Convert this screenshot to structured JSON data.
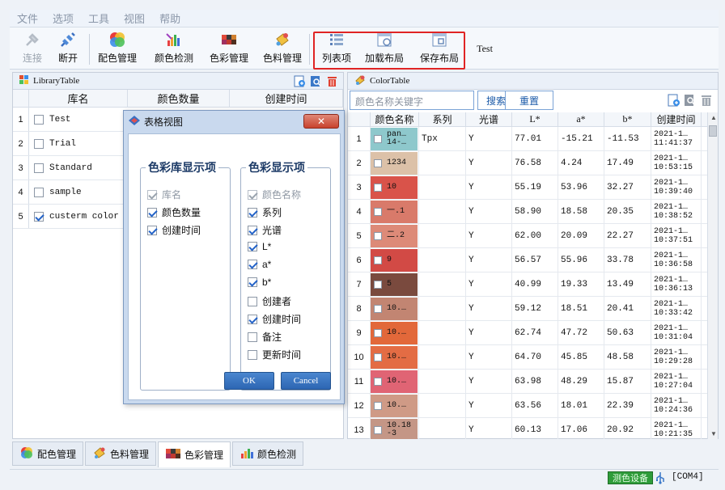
{
  "menu": [
    "文件",
    "选项",
    "工具",
    "视图",
    "帮助"
  ],
  "toolbar": {
    "connect": "连接",
    "disconnect": "断开",
    "color_match": "配色管理",
    "color_detect": "颜色检测",
    "color_manage": "色彩管理",
    "material_manage": "色料管理",
    "list_options": "列表项",
    "load_layout": "加载布局",
    "save_layout": "保存布局",
    "test": "Test"
  },
  "library": {
    "title": "LibraryTable",
    "columns": [
      "库名",
      "颜色数量",
      "创建时间"
    ],
    "rows": [
      {
        "num": "1",
        "name": "Test",
        "checked": false
      },
      {
        "num": "2",
        "name": "Trial",
        "checked": false
      },
      {
        "num": "3",
        "name": "Standard",
        "checked": false
      },
      {
        "num": "4",
        "name": "sample",
        "checked": false
      },
      {
        "num": "5",
        "name": "custerm color",
        "checked": true
      }
    ]
  },
  "colortable": {
    "title": "ColorTable",
    "search_placeholder": "颜色名称关键字",
    "search_btn": "搜索",
    "reset_btn": "重置",
    "columns": [
      "颜色名称",
      "系列",
      "光谱",
      "L*",
      "a*",
      "b*",
      "创建时间"
    ],
    "rows": [
      {
        "num": "1",
        "swatch": "#8ec8cc",
        "name": "pan…\n14-…",
        "series": "Tpx",
        "spectrum": "Y",
        "L": "77.01",
        "a": "-15.21",
        "b": "-11.53",
        "date": "2021-1…",
        "time": "11:41:37"
      },
      {
        "num": "2",
        "swatch": "#dcc1a8",
        "name": "1234",
        "series": "",
        "spectrum": "Y",
        "L": "76.58",
        "a": "4.24",
        "b": "17.49",
        "date": "2021-1…",
        "time": "10:53:15"
      },
      {
        "num": "3",
        "swatch": "#d9534a",
        "name": "10",
        "series": "",
        "spectrum": "Y",
        "L": "55.19",
        "a": "53.96",
        "b": "32.27",
        "date": "2021-1…",
        "time": "10:39:40"
      },
      {
        "num": "4",
        "swatch": "#d97a6a",
        "name": "一.1",
        "series": "",
        "spectrum": "Y",
        "L": "58.90",
        "a": "18.58",
        "b": "20.35",
        "date": "2021-1…",
        "time": "10:38:52"
      },
      {
        "num": "5",
        "swatch": "#dd8a78",
        "name": "二.2",
        "series": "",
        "spectrum": "Y",
        "L": "62.00",
        "a": "20.09",
        "b": "22.27",
        "date": "2021-1…",
        "time": "10:37:51"
      },
      {
        "num": "6",
        "swatch": "#d24a45",
        "name": "9",
        "series": "",
        "spectrum": "Y",
        "L": "56.57",
        "a": "55.96",
        "b": "33.78",
        "date": "2021-1…",
        "time": "10:36:58"
      },
      {
        "num": "7",
        "swatch": "#7a4a3e",
        "name": "5",
        "series": "",
        "spectrum": "Y",
        "L": "40.99",
        "a": "19.33",
        "b": "13.49",
        "date": "2021-1…",
        "time": "10:36:13"
      },
      {
        "num": "8",
        "swatch": "#c28572",
        "name": "10.…",
        "series": "",
        "spectrum": "Y",
        "L": "59.12",
        "a": "18.51",
        "b": "20.41",
        "date": "2021-1…",
        "time": "10:33:42"
      },
      {
        "num": "9",
        "swatch": "#e2683a",
        "name": "10.…",
        "series": "",
        "spectrum": "Y",
        "L": "62.74",
        "a": "47.72",
        "b": "50.63",
        "date": "2021-1…",
        "time": "10:31:04"
      },
      {
        "num": "10",
        "swatch": "#e36c44",
        "name": "10.…",
        "series": "",
        "spectrum": "Y",
        "L": "64.70",
        "a": "45.85",
        "b": "48.58",
        "date": "2021-1…",
        "time": "10:29:28"
      },
      {
        "num": "11",
        "swatch": "#e06474",
        "name": "10.…",
        "series": "",
        "spectrum": "Y",
        "L": "63.98",
        "a": "48.29",
        "b": "15.87",
        "date": "2021-1…",
        "time": "10:27:04"
      },
      {
        "num": "12",
        "swatch": "#cf9a86",
        "name": "10.…",
        "series": "",
        "spectrum": "Y",
        "L": "63.56",
        "a": "18.01",
        "b": "22.39",
        "date": "2021-1…",
        "time": "10:24:36"
      },
      {
        "num": "13",
        "swatch": "#c49686",
        "name": "10.18\n-3",
        "series": "",
        "spectrum": "Y",
        "L": "60.13",
        "a": "17.06",
        "b": "20.92",
        "date": "2021-1…",
        "time": "10:21:35"
      }
    ]
  },
  "dialog": {
    "title": "表格视图",
    "lib_group": "色彩库显示项",
    "lib_items": [
      {
        "label": "库名",
        "checked": true,
        "disabled": true
      },
      {
        "label": "颜色数量",
        "checked": true,
        "disabled": false
      },
      {
        "label": "创建时间",
        "checked": true,
        "disabled": false
      }
    ],
    "color_group": "色彩显示项",
    "color_items": [
      {
        "label": "颜色名称",
        "checked": true,
        "disabled": true
      },
      {
        "label": "系列",
        "checked": true,
        "disabled": false
      },
      {
        "label": "光谱",
        "checked": true,
        "disabled": false
      },
      {
        "label": "L*",
        "checked": true,
        "disabled": false
      },
      {
        "label": "a*",
        "checked": true,
        "disabled": false
      },
      {
        "label": "b*",
        "checked": true,
        "disabled": false
      },
      {
        "label": "创建者",
        "checked": false,
        "disabled": false
      },
      {
        "label": "创建时间",
        "checked": true,
        "disabled": false
      },
      {
        "label": "备注",
        "checked": false,
        "disabled": false
      },
      {
        "label": "更新时间",
        "checked": false,
        "disabled": false
      }
    ],
    "ok": "OK",
    "cancel": "Cancel"
  },
  "bottom_tabs": [
    {
      "label": "配色管理",
      "active": false
    },
    {
      "label": "色料管理",
      "active": false
    },
    {
      "label": "色彩管理",
      "active": true
    },
    {
      "label": "颜色检测",
      "active": false
    }
  ],
  "status": {
    "device_label": "测色设备",
    "port": "[COM4]"
  }
}
